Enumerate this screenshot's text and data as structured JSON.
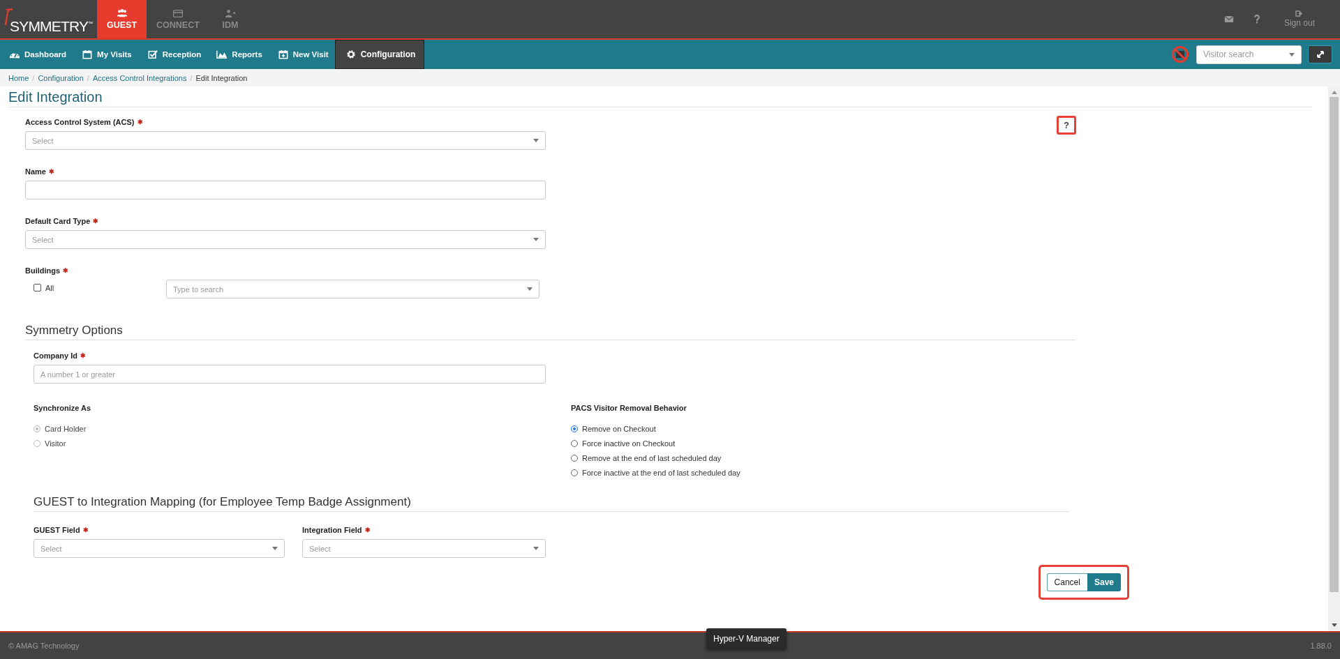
{
  "brand": {
    "name": "SYMMETRY",
    "trademark": "™"
  },
  "product_tabs": [
    {
      "label": "GUEST",
      "selected": true
    },
    {
      "label": "CONNECT",
      "selected": false
    },
    {
      "label": "IDM",
      "selected": false
    }
  ],
  "top_actions": {
    "sign_out": "Sign out"
  },
  "nav": [
    {
      "label": "Dashboard",
      "selected": false
    },
    {
      "label": "My Visits",
      "selected": false
    },
    {
      "label": "Reception",
      "selected": false
    },
    {
      "label": "Reports",
      "selected": false
    },
    {
      "label": "New Visit",
      "selected": false
    },
    {
      "label": "Configuration",
      "selected": true
    }
  ],
  "visitor_search": {
    "placeholder": "Visitor search"
  },
  "breadcrumb": [
    {
      "label": "Home",
      "separator": "/"
    },
    {
      "label": "Configuration",
      "separator": "/"
    },
    {
      "label": "Access Control Integrations",
      "separator": "/"
    },
    {
      "label": "Edit Integration"
    }
  ],
  "page_title": "Edit Integration",
  "help_button": {
    "label": "?",
    "highlight": true
  },
  "fields": [
    {
      "label": "Access Control System (ACS)",
      "required_mark": "✱",
      "kind": "select",
      "placeholder": "Select"
    },
    {
      "label": "Name",
      "required_mark": "✱",
      "kind": "text"
    },
    {
      "label": "Default Card Type",
      "required_mark": "✱",
      "kind": "select",
      "placeholder": "Select"
    }
  ],
  "buildings": {
    "label": "Buildings",
    "required_mark": "✱",
    "all_label": "All",
    "all_checked": false,
    "placeholder": "Type to search"
  },
  "symmetry_options": {
    "heading": "Symmetry Options",
    "company_id": {
      "label": "Company Id",
      "required_mark": "✱",
      "placeholder": "A number 1 or greater"
    },
    "synchronize_as": {
      "label": "Synchronize As",
      "disabled": true,
      "options": [
        {
          "label": "Card Holder",
          "selected": true
        },
        {
          "label": "Visitor",
          "selected": false
        }
      ]
    },
    "removal_behavior": {
      "label": "PACS Visitor Removal Behavior",
      "disabled": false,
      "options": [
        {
          "label": "Remove on Checkout",
          "selected": true
        },
        {
          "label": "Force inactive on Checkout",
          "selected": false
        },
        {
          "label": "Remove at the end of last scheduled day",
          "selected": false
        },
        {
          "label": "Force inactive at the end of last scheduled day",
          "selected": false
        }
      ]
    }
  },
  "mapping": {
    "heading": "GUEST to Integration Mapping (for Employee Temp Badge Assignment)",
    "fields": [
      {
        "label": "GUEST Field",
        "required_mark": "✱",
        "placeholder": "Select"
      },
      {
        "label": "Integration Field",
        "required_mark": "✱",
        "placeholder": "Select"
      }
    ]
  },
  "actions": {
    "cancel": "Cancel",
    "save": "Save",
    "highlight": true
  },
  "footer": {
    "copyright": "© AMAG Technology",
    "version": "1.88.0"
  },
  "tooltip": "Hyper-V Manager"
}
